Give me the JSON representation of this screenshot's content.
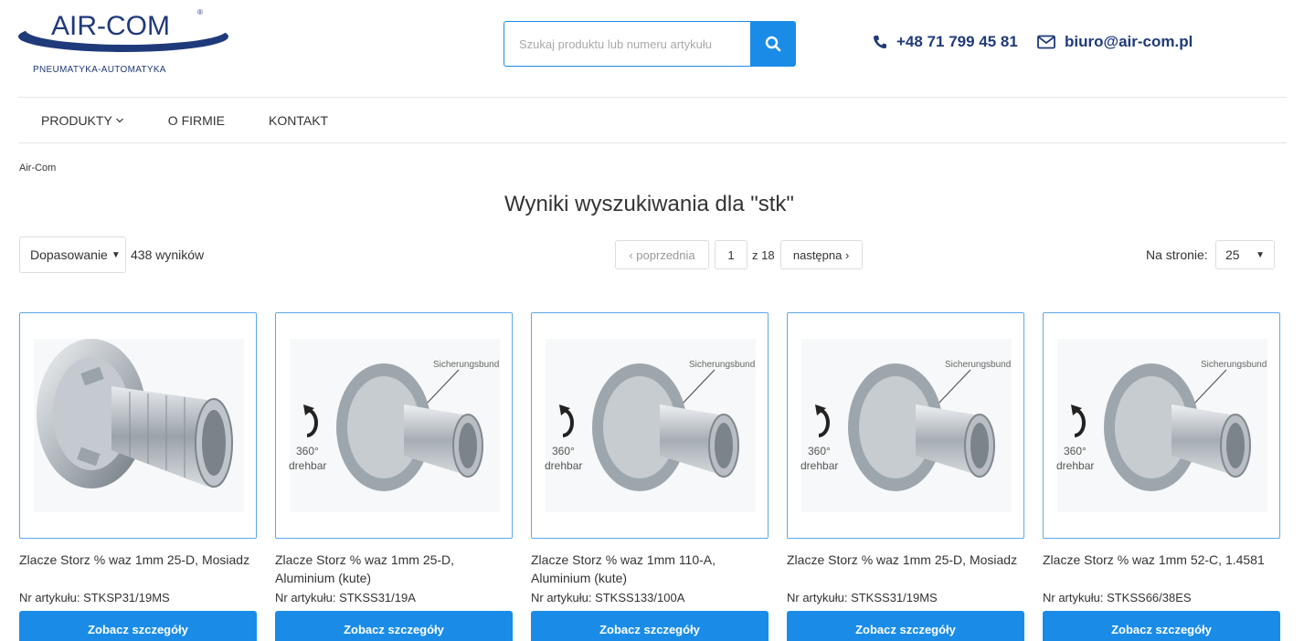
{
  "header": {
    "logo_text": "AIR-COM",
    "logo_tagline": "PNEUMATYKA-AUTOMATYKA",
    "search_placeholder": "Szukaj produktu lub numeru artykułu",
    "phone": "+48 71 799 45 81",
    "email": "biuro@air-com.pl"
  },
  "nav": {
    "items": [
      {
        "label": "PRODUKTY",
        "has_dropdown": true
      },
      {
        "label": "O FIRMIE"
      },
      {
        "label": "KONTAKT"
      }
    ]
  },
  "breadcrumb": "Air-Com",
  "page_title": "Wyniki wyszukiwania dla \"stk\"",
  "toolbar": {
    "sort_label": "Dopasowanie",
    "results_count": "438 wyników",
    "prev_label": "‹ poprzednia",
    "current_page": "1",
    "total_pages": "z 18",
    "next_label": "następna ›",
    "per_page_label": "Na stronie:",
    "per_page_value": "25"
  },
  "products": [
    {
      "name": "Zlacze Storz % waz 1mm 25-D, Mosiadz",
      "sku": "Nr artykułu: STKSP31/19MS",
      "button": "Zobacz szczegóły",
      "image": "storz-coupling-ribbed"
    },
    {
      "name": "Zlacze Storz % waz 1mm 25-D, Aluminium (kute)",
      "sku": "Nr artykułu: STKSS31/19A",
      "button": "Zobacz szczegóły",
      "image": "storz-coupling-360",
      "img_label": "Sicherungsbund",
      "rot1": "360°",
      "rot2": "drehbar"
    },
    {
      "name": "Zlacze Storz % waz 1mm 110-A, Aluminium (kute)",
      "sku": "Nr artykułu: STKSS133/100A",
      "button": "Zobacz szczegóły",
      "image": "storz-coupling-360",
      "img_label": "Sicherungsbund",
      "rot1": "360°",
      "rot2": "drehbar"
    },
    {
      "name": "Zlacze Storz % waz 1mm 25-D, Mosiadz",
      "sku": "Nr artykułu: STKSS31/19MS",
      "button": "Zobacz szczegóły",
      "image": "storz-coupling-360",
      "img_label": "Sicherungsbund",
      "rot1": "360°",
      "rot2": "drehbar"
    },
    {
      "name": "Zlacze Storz % waz 1mm 52-C, 1.4581",
      "sku": "Nr artykułu: STKSS66/38ES",
      "button": "Zobacz szczegóły",
      "image": "storz-coupling-360",
      "img_label": "Sicherungsbund",
      "rot1": "360°",
      "rot2": "drehbar"
    }
  ],
  "colors": {
    "accent": "#1a8ce8",
    "brand": "#1f3a7a",
    "card_border": "#5ea8e8"
  }
}
